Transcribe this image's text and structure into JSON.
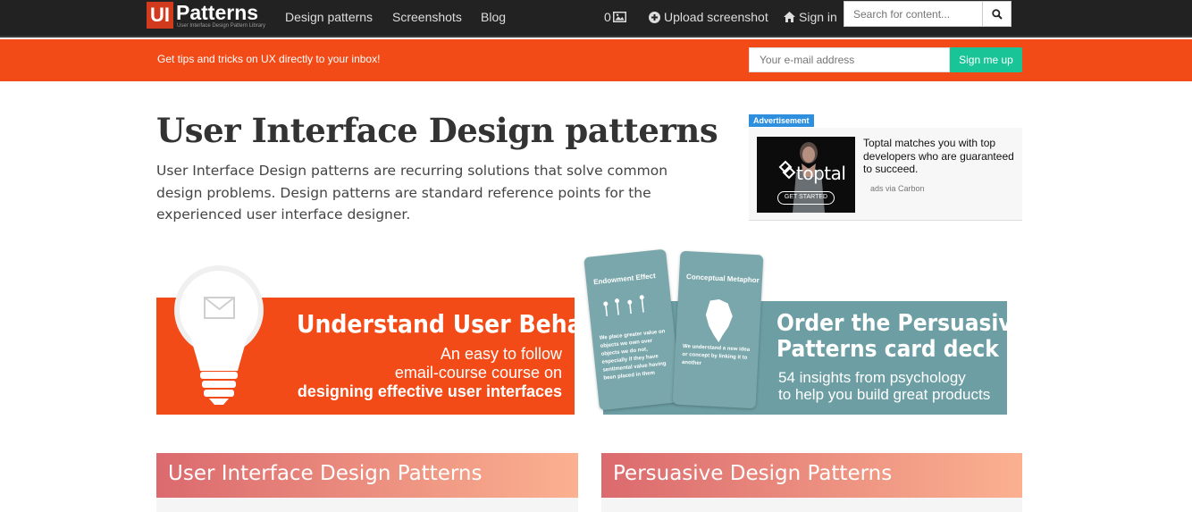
{
  "header": {
    "logo_ui": "UI",
    "logo_patterns": "Patterns",
    "logo_tagline": "User Interface Design Pattern Library",
    "nav": [
      "Design patterns",
      "Screenshots",
      "Blog"
    ],
    "counter": "0",
    "upload_label": "Upload screenshot",
    "signin_label": "Sign in",
    "search_placeholder": "Search for content..."
  },
  "subscribe": {
    "text": "Get tips and tricks on UX directly to your inbox!",
    "email_placeholder": "Your e-mail address",
    "button_label": "Sign me up"
  },
  "hero": {
    "title": "User Interface Design patterns",
    "description": "User Interface Design patterns are recurring solutions that solve common design problems. Design patterns are standard reference points for the experienced user interface designer."
  },
  "ad": {
    "label": "Advertisement",
    "brand": "toptal",
    "cta": "GET STARTED",
    "text": "Toptal matches you with top developers who are guaranteed to succeed.",
    "via": "ads via Carbon"
  },
  "banner_behavior": {
    "title": "Understand User Behavior",
    "line1": "An easy to follow",
    "line2": "email-course course on",
    "line3": "designing effective user interfaces"
  },
  "banner_cards": {
    "card1_title": "Endowment Effect",
    "card1_text": "We place greater value on objects we own over objects we do not, especially if they have sentimental value having been placed in them",
    "card2_title": "Conceptual Metaphor",
    "card2_text": "We understand a new idea or concept by linking it to another",
    "title_line1": "Order the Persuasive",
    "title_line2": "Patterns card deck",
    "sub_line1": "54 insights from psychology",
    "sub_line2": "to help you build great products"
  },
  "sections": [
    {
      "title": "User Interface Design Patterns"
    },
    {
      "title": "Persuasive Design Patterns"
    }
  ],
  "colors": {
    "navbar": "#222222",
    "brand_orange": "#f24b18",
    "signup_green": "#19c596",
    "teal": "#6c9ea3",
    "ad_blue": "#2d8fdd"
  }
}
